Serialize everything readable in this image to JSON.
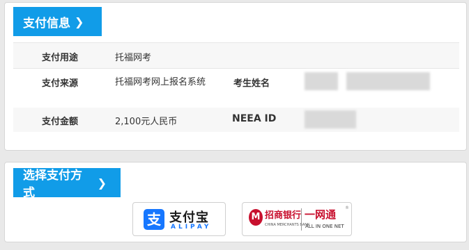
{
  "payment_info": {
    "header": "支付信息",
    "chevron": "❯",
    "rows": [
      {
        "label": "支付用途",
        "value": "托福网考"
      },
      {
        "label": "支付来源",
        "value": "托福网考网上报名系统",
        "label2": "考生姓名"
      },
      {
        "label": "支付金额",
        "value": "2,100元人民币",
        "label2": "NEEA ID"
      }
    ]
  },
  "payment_method": {
    "header": "选择支付方式",
    "chevron": "❯",
    "alipay": {
      "cn": "支付宝",
      "en": "ALIPAY",
      "icon": "支"
    },
    "cmb": {
      "cn": "招商银行",
      "en": "CHINA MERCHANTS BANK",
      "brand": "一网通",
      "brand_en": "ALL IN ONE NET",
      "reg": "®"
    }
  },
  "colors": {
    "accent": "#119ce8",
    "alipay_blue": "#1677ff",
    "cmb_red": "#c8102e"
  }
}
